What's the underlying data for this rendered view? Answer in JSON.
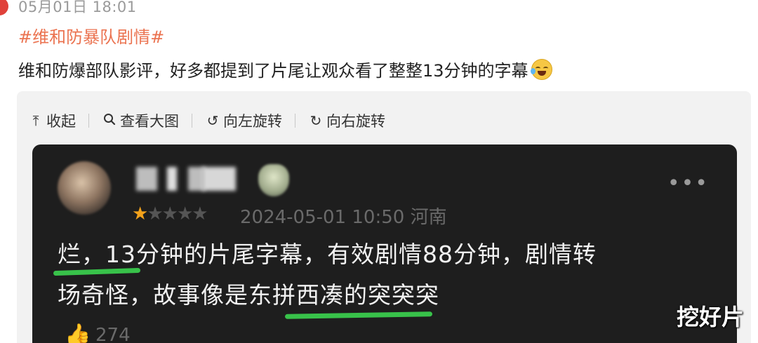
{
  "post": {
    "timestamp": "05月01日 18:01",
    "hashtag": "#维和防暴队剧情#",
    "text": "维和防爆部队影评，好多都提到了片尾让观众看了整整13分钟的字幕",
    "emoji": "crying-laughing-face"
  },
  "toolbar": {
    "collapse_label": "收起",
    "view_large_label": "查看大图",
    "rotate_left_label": "向左旋转",
    "rotate_right_label": "向右旋转"
  },
  "review": {
    "rating": 1,
    "max_rating": 5,
    "date": "2024-05-01 10:50",
    "location": "河南",
    "line1": "烂，13分钟的片尾字幕，有效剧情88分钟，剧情转",
    "line2": "场奇怪，故事像是东拼西凑的突突突",
    "like_count": "274",
    "more_label": "•••",
    "highlight_color": "#38c24a"
  },
  "watermark": "挖好片",
  "colors": {
    "hashtag": "#eb7350",
    "star_active": "#f3a21b",
    "card_bg": "#1e1e1e"
  }
}
